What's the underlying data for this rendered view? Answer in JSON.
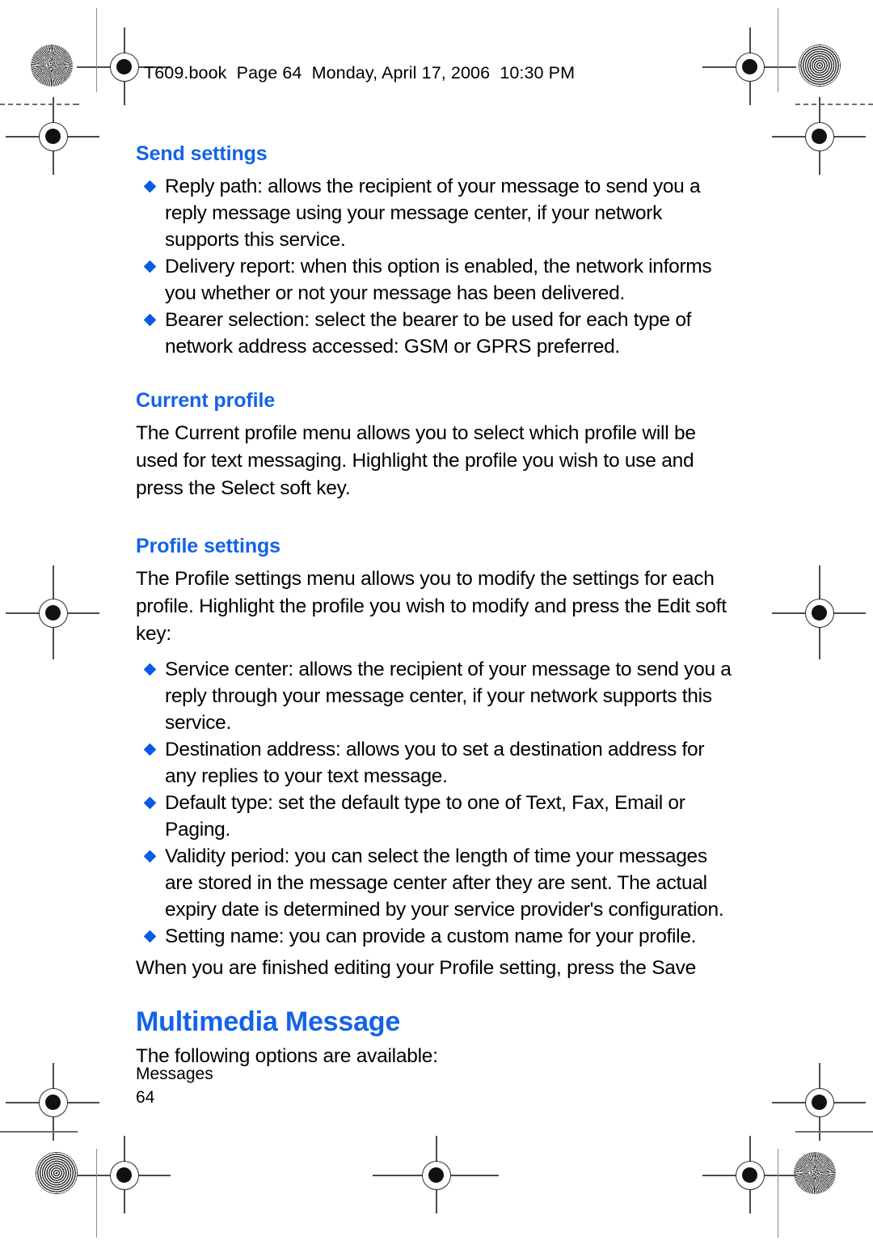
{
  "page": {
    "header_line": "T609.book  Page 64  Monday, April 17, 2006  10:30 PM",
    "footer_section": "Messages",
    "footer_page_number": "64",
    "accent_color": "#1463e6",
    "bullet_color": "#0a5ae8",
    "text_color": "#000000",
    "background_color": "#ffffff"
  },
  "sections": [
    {
      "heading": "Send settings",
      "bullets": [
        "Reply path: allows the recipient of your message to send you a reply message using your message center, if your network supports this service.",
        "Delivery report: when this option is enabled, the network informs you whether or not your message has been delivered.",
        "Bearer selection: select the bearer to be used for each type of network address accessed: GSM or GPRS preferred."
      ]
    },
    {
      "heading": "Current profile",
      "paragraph": "The Current profile menu allows you to select which profile will be used for text messaging. Highlight the profile you wish to use and press the Select soft key."
    },
    {
      "heading": "Profile settings",
      "paragraph": "The Profile settings menu allows you to modify the settings for each profile. Highlight the profile you wish to modify and press the Edit soft key:",
      "bullets": [
        "Service center: allows the recipient of your message to send you a reply through your message center, if your network supports this service.",
        "Destination address: allows you to set a destination address for any replies to your text message.",
        "Default type: set the default type to one of Text, Fax, Email or Paging.",
        "Validity period: you can select the length of time your messages are stored in the message center after they are sent. The actual expiry date is determined by your service provider's configuration.",
        "Setting name: you can provide a custom name for your profile."
      ],
      "trailing_paragraph": "When you are finished editing your Profile setting, press the Save"
    }
  ],
  "chapter": {
    "title": "Multimedia Message",
    "intro": "The following options are available:"
  }
}
